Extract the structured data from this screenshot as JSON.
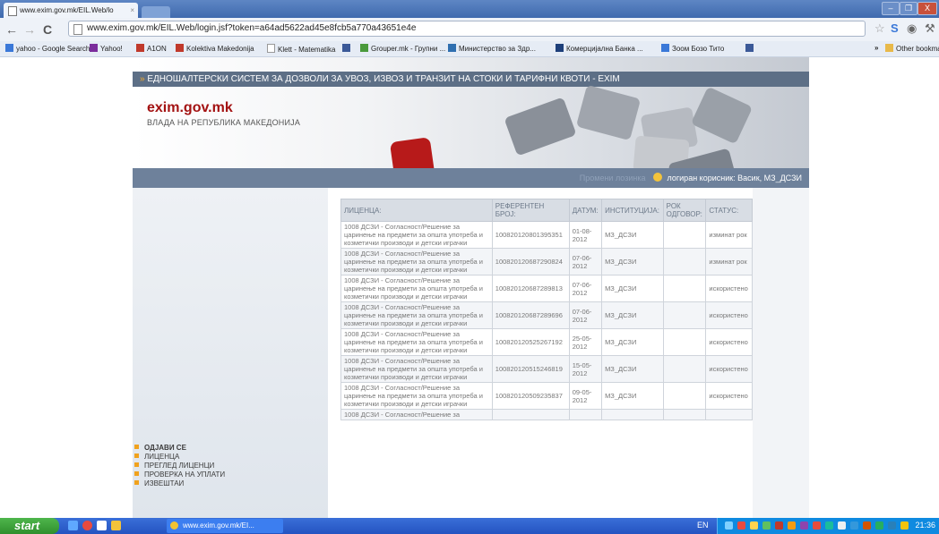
{
  "browser": {
    "tab_title": "www.exim.gov.mk/EIL.Web/lo",
    "tab_close": "×",
    "url": "www.exim.gov.mk/EIL.Web/login.jsf?token=a64ad5622ad45e8fcb5a770a43651e4e",
    "window_buttons": [
      "–",
      "❐",
      "X"
    ],
    "bookmarks": [
      {
        "label": "yahoo - Google Search",
        "icon": "google-icon",
        "color": "#3a78d8"
      },
      {
        "label": "Yahoo!",
        "icon": "yahoo-icon",
        "color": "#7b2d9c"
      },
      {
        "label": "A1ON",
        "icon": "a1-icon",
        "color": "#c0392b"
      },
      {
        "label": "Kolektiva Makedonija",
        "icon": "k-icon",
        "color": "#c0392b"
      },
      {
        "label": "Klett - Matematika",
        "icon": "page-icon",
        "color": "#999999"
      },
      {
        "label": "",
        "icon": "facebook-icon",
        "color": "#3b5998"
      },
      {
        "label": "Grouper.mk - Групни ...",
        "icon": "grouper-icon",
        "color": "#4a9a3c"
      },
      {
        "label": "Министерство за Здр...",
        "icon": "ministry-icon",
        "color": "#2f6fb0"
      },
      {
        "label": "Комерцијална Банка ...",
        "icon": "bank-icon",
        "color": "#1d3f7a"
      },
      {
        "label": "Зоом Бозо Тито",
        "icon": "zoom-icon",
        "color": "#3a78d8"
      },
      {
        "label": "",
        "icon": "facebook-icon",
        "color": "#3b5998"
      }
    ],
    "bookmarks_overflow": "»",
    "other_bookmarks": "Other bookmarks"
  },
  "site": {
    "header_strip": "ЕДНОШАЛТЕРСКИ СИСТЕМ ЗА ДОЗВОЛИ ЗА УВОЗ, ИЗВОЗ И ТРАНЗИТ НА СТОКИ И ТАРИФНИ КВОТИ - EXIM",
    "title": "exim.gov.mk",
    "subtitle": "ВЛАДА НА РЕПУБЛИКА МАКЕДОНИЈА",
    "user_faint": "Промени лозинка",
    "user_info": "логиран корисник: Васик, МЗ_ДСЗИ"
  },
  "nav": [
    "ОДЈАВИ СЕ",
    "ЛИЦЕНЦА",
    "ПРЕГЛЕД ЛИЦЕНЦИ",
    "ПРОВЕРКА НА УПЛАТИ",
    "ИЗВЕШТАИ"
  ],
  "table": {
    "headers": [
      "ЛИЦЕНЦА:",
      "РЕФЕРЕНТЕН БРОЈ:",
      "ДАТУМ:",
      "ИНСТИТУЦИЈА:",
      "РОК ОДГОВОР:",
      "СТАТУС:"
    ],
    "rows": [
      {
        "license": "1008 ДСЗИ - Согласност/Решение за царинење на предмети за општа употреба и козметички производи и детски играчки",
        "ref": "100820120801395351",
        "date": "01-08-2012",
        "inst": "МЗ_ДСЗИ",
        "deadline": "",
        "status": "изминат рок"
      },
      {
        "license": "1008 ДСЗИ - Согласност/Решение за царинење на предмети за општа употреба и козметички производи и детски играчки",
        "ref": "100820120687290824",
        "date": "07-06-2012",
        "inst": "МЗ_ДСЗИ",
        "deadline": "",
        "status": "изминат рок"
      },
      {
        "license": "1008 ДСЗИ - Согласност/Решение за царинење на предмети за општа употреба и козметички производи и детски играчки",
        "ref": "100820120687289813",
        "date": "07-06-2012",
        "inst": "МЗ_ДСЗИ",
        "deadline": "",
        "status": "искористено"
      },
      {
        "license": "1008 ДСЗИ - Согласност/Решение за царинење на предмети за општа употреба и козметички производи и детски играчки",
        "ref": "100820120687289696",
        "date": "07-06-2012",
        "inst": "МЗ_ДСЗИ",
        "deadline": "",
        "status": "искористено"
      },
      {
        "license": "1008 ДСЗИ - Согласност/Решение за царинење на предмети за општа употреба и козметички производи и детски играчки",
        "ref": "100820120525267192",
        "date": "25-05-2012",
        "inst": "МЗ_ДСЗИ",
        "deadline": "",
        "status": "искористено"
      },
      {
        "license": "1008 ДСЗИ - Согласност/Решение за царинење на предмети за општа употреба и козметички производи и детски играчки",
        "ref": "100820120515246819",
        "date": "15-05-2012",
        "inst": "МЗ_ДСЗИ",
        "deadline": "",
        "status": "искористено"
      },
      {
        "license": "1008 ДСЗИ - Согласност/Решение за царинење на предмети за општа употреба и козметички производи и детски играчки",
        "ref": "100820120509235837",
        "date": "09-05-2012",
        "inst": "МЗ_ДСЗИ",
        "deadline": "",
        "status": "искористено"
      },
      {
        "license": "1008 ДСЗИ - Согласност/Решение за",
        "ref": "",
        "date": "",
        "inst": "",
        "deadline": "",
        "status": ""
      }
    ]
  },
  "taskbar": {
    "start": "start",
    "task_title": "www.exim.gov.mk/EI...",
    "lang": "EN",
    "clock": "21:36"
  }
}
